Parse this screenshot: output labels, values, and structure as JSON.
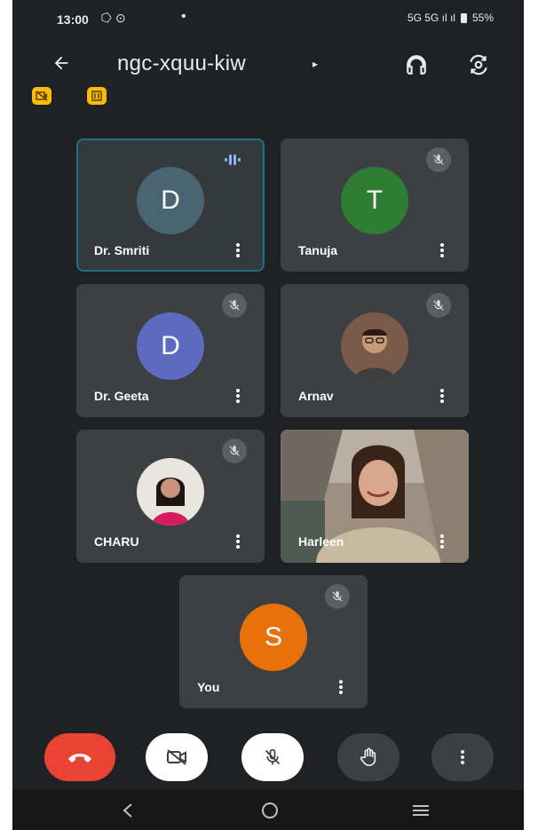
{
  "status_bar": {
    "time": "13:00",
    "left_icons": "⭔ ⊙",
    "dot": "•",
    "network": "5G 5G ıl ıl",
    "battery": "55%"
  },
  "header": {
    "meeting_code": "ngc-xquu-kiw",
    "icons": [
      "back-arrow-icon",
      "chevron-right-icon",
      "headphones-icon",
      "switch-camera-icon"
    ]
  },
  "badges": [
    "camera-off-badge",
    "captions-badge"
  ],
  "participants": [
    {
      "name": "Dr. Smriti",
      "initial": "D",
      "avatar_color": "#4a6572",
      "muted": false,
      "speaking": true
    },
    {
      "name": "Tanuja",
      "initial": "T",
      "avatar_color": "#2e7d32",
      "muted": true,
      "speaking": false
    },
    {
      "name": "Dr. Geeta",
      "initial": "D",
      "avatar_color": "#5c6bc0",
      "muted": true,
      "speaking": false
    },
    {
      "name": "Arnav",
      "initial": "",
      "avatar_color": "#8d6e63",
      "muted": true,
      "speaking": false
    },
    {
      "name": "CHARU",
      "initial": "",
      "avatar_color": "#c2185b",
      "muted": true,
      "speaking": false
    },
    {
      "name": "Harleen",
      "initial": "",
      "avatar_color": "#8a7a6a",
      "muted": false,
      "speaking": false
    },
    {
      "name": "You",
      "initial": "S",
      "avatar_color": "#e8710a",
      "muted": true,
      "speaking": false
    }
  ],
  "controls": [
    "end-call-icon",
    "camera-off-icon",
    "mic-off-icon",
    "raise-hand-icon",
    "more-options-icon"
  ],
  "colors": {
    "background": "#202124",
    "tile": "#3c4043",
    "end_call": "#ea4335",
    "badge": "#fbbc04"
  }
}
